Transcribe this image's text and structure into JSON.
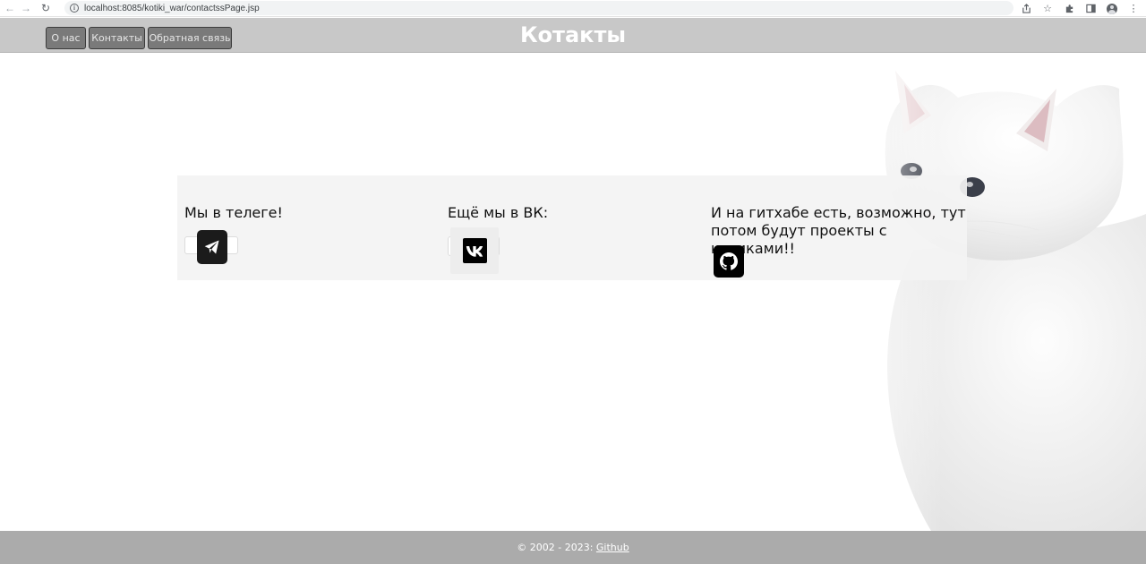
{
  "browser": {
    "url": "localhost:8085/kotiki_war/contactssPage.jsp"
  },
  "header": {
    "title": "Котакты",
    "nav": [
      {
        "label": "О нас"
      },
      {
        "label": "Контакты"
      },
      {
        "label": "Обратная связь"
      }
    ],
    "background_color": "#c8c8c8"
  },
  "contacts": {
    "telegram": {
      "heading": "Мы в телеге!",
      "icon": "telegram-icon"
    },
    "vk": {
      "heading": "Ещё мы в ВК:",
      "icon": "vk-icon"
    },
    "github": {
      "heading_line1": "И на гитхабе есть, возможно, тут",
      "heading_line2": "потом будут проекты с котиками!!",
      "icon": "github-icon"
    }
  },
  "footer": {
    "text": "© 2002 - 2023: ",
    "link": "Github",
    "background_color": "#ababab"
  }
}
